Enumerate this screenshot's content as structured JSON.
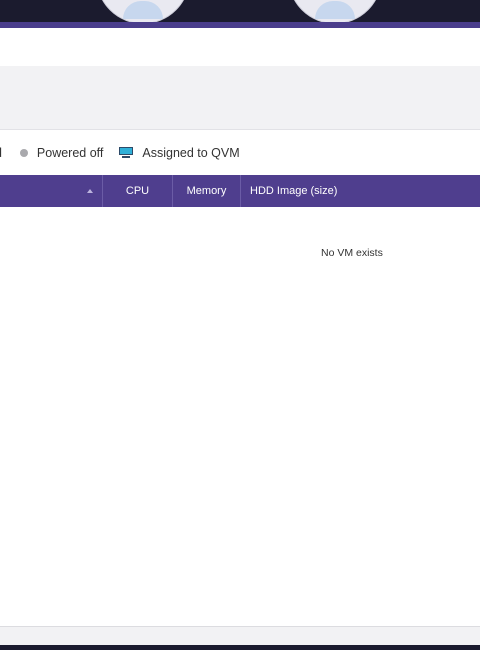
{
  "legend": {
    "partial_label": "ed",
    "powered_off_label": "Powered off",
    "qvm_label": "Assigned to QVM"
  },
  "table": {
    "columns": {
      "cpu": "CPU",
      "memory": "Memory",
      "hdd": "HDD Image (size)"
    },
    "empty_message": "No VM exists"
  },
  "icons": {
    "sort": "sort-ascending-icon",
    "powered_off": "status-dot-icon",
    "qvm": "monitor-icon"
  },
  "colors": {
    "header_purple": "#4f3e8e",
    "accent_purple": "#4a3d8c",
    "powered_off_gray": "#a9a9ad",
    "qvm_blue": "#2fb0d8"
  }
}
